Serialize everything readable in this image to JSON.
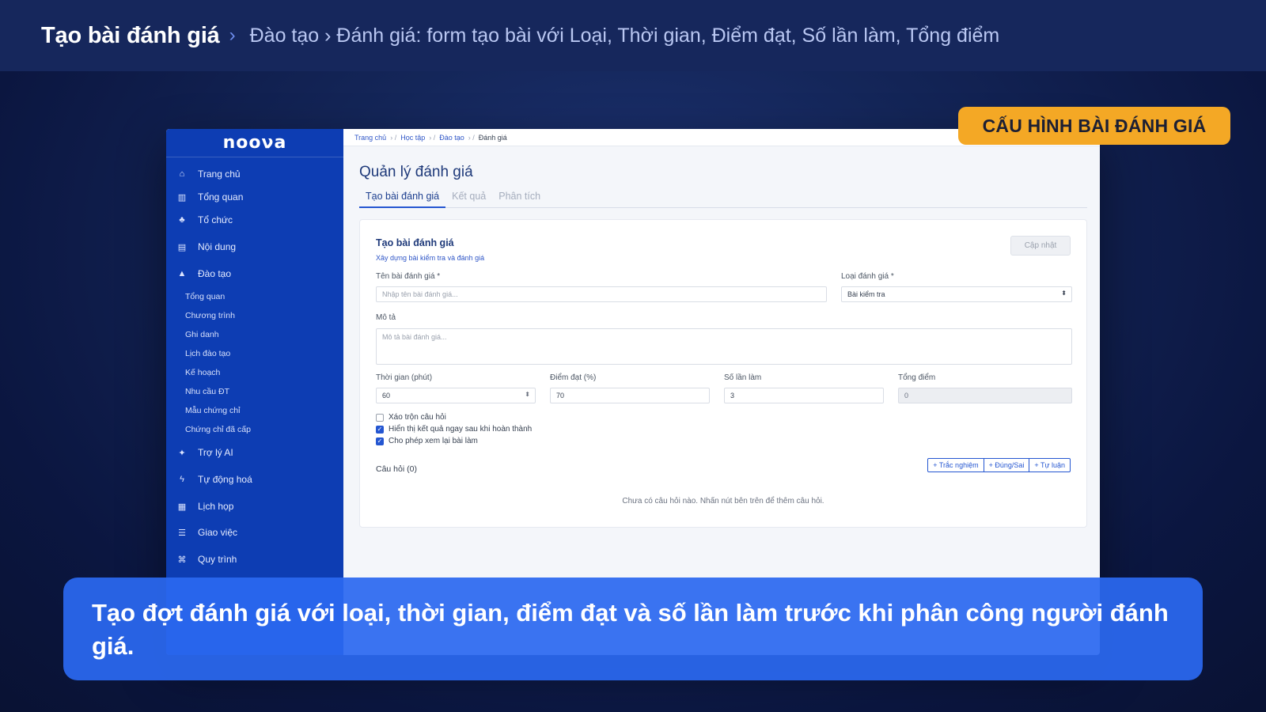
{
  "header": {
    "title": "Tạo bài đánh giá",
    "separator": "›",
    "subtitle": "Đào tạo › Đánh giá: form tạo bài với Loại, Thời gian, Điểm đạt, Số lần làm, Tổng điểm"
  },
  "badge": {
    "label": "CẤU HÌNH BÀI ĐÁNH GIÁ",
    "color": "#f4a825"
  },
  "caption": {
    "text": "Tạo đợt đánh giá với loại, thời gian, điểm đạt và số lần làm trước khi phân công người đánh giá."
  },
  "app": {
    "logo": "nooνa",
    "sidebar": {
      "items": [
        {
          "label": "Trang chủ",
          "icon": "home-icon",
          "glyph": "⌂"
        },
        {
          "label": "Tổng quan",
          "icon": "bar-chart-icon",
          "glyph": "▥"
        },
        {
          "label": "Tổ chức",
          "icon": "org-chart-icon",
          "glyph": "♣"
        },
        {
          "label": "Nội dung",
          "icon": "book-icon",
          "glyph": "▤"
        },
        {
          "label": "Đào tạo",
          "icon": "graduation-cap-icon",
          "glyph": "▲"
        }
      ],
      "sub_items": [
        "Tổng quan",
        "Chương trình",
        "Ghi danh",
        "Lịch đào tạo",
        "Kế hoạch",
        "Nhu cầu ĐT",
        "Mẫu chứng chỉ",
        "Chứng chỉ đã cấp"
      ],
      "items_after": [
        {
          "label": "Trợ lý AI",
          "icon": "sparkle-icon",
          "glyph": "✦"
        },
        {
          "label": "Tự động hoá",
          "icon": "lightning-icon",
          "glyph": "ϟ"
        },
        {
          "label": "Lịch họp",
          "icon": "calendar-icon",
          "glyph": "▦"
        },
        {
          "label": "Giao việc",
          "icon": "tasks-icon",
          "glyph": "☰"
        },
        {
          "label": "Quy trình",
          "icon": "workflow-icon",
          "glyph": "⌘"
        }
      ]
    },
    "breadcrumb": [
      "Trang chủ",
      "Học tập",
      "Đào tạo",
      "Đánh giá"
    ],
    "page_title": "Quản lý đánh giá",
    "tabs": [
      "Tạo bài đánh giá",
      "Kết quả",
      "Phân tích"
    ],
    "form": {
      "title": "Tạo bài đánh giá",
      "subtitle": "Xây dựng bài kiểm tra và đánh giá",
      "update_button": "Cập nhật",
      "name_label": "Tên bài đánh giá *",
      "name_placeholder": "Nhập tên bài đánh giá...",
      "type_label": "Loại đánh giá *",
      "type_value": "Bài kiểm tra",
      "desc_label": "Mô tả",
      "desc_placeholder": "Mô tả bài đánh giá...",
      "time_label": "Thời gian (phút)",
      "time_value": "60",
      "pass_label": "Điểm đạt (%)",
      "pass_value": "70",
      "attempts_label": "Số lần làm",
      "attempts_value": "3",
      "total_label": "Tổng điểm",
      "total_value": "0",
      "options": [
        {
          "label": "Xáo trộn câu hỏi",
          "checked": false
        },
        {
          "label": "Hiển thị kết quả ngay sau khi hoàn thành",
          "checked": true
        },
        {
          "label": "Cho phép xem lại bài làm",
          "checked": true
        }
      ],
      "questions_label": "Câu hỏi (0)",
      "question_buttons": [
        "+ Trắc nghiệm",
        "+ Đúng/Sai",
        "+ Tự luận"
      ],
      "empty_text": "Chưa có câu hỏi nào. Nhấn nút bên trên để thêm câu hỏi."
    }
  }
}
